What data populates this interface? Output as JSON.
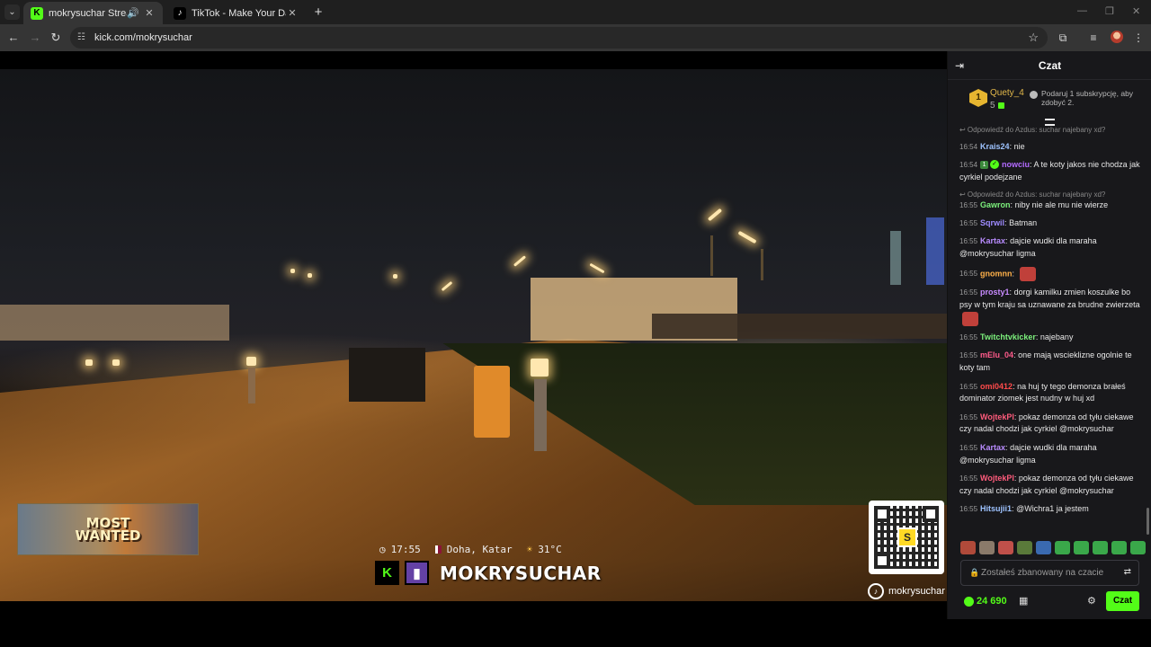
{
  "browser": {
    "tabs": [
      {
        "title": "mokrysuchar Stream - Watc",
        "active": true,
        "favicon": "kick-icon",
        "audio": true
      },
      {
        "title": "TikTok - Make Your Day",
        "active": false,
        "favicon": "tiktok-icon"
      }
    ],
    "url": "kick.com/mokrysuchar"
  },
  "video": {
    "overlay_ad_text": "MOST\nWANTED",
    "info": {
      "time": "17:55",
      "location": "Doha, Katar",
      "temperature": "31°C"
    },
    "streamer_name": "MOKRYSUCHAR",
    "qr_label": "S",
    "handle": "mokrysuchar"
  },
  "chat": {
    "title": "Czat",
    "leaderboard": {
      "rank": "1",
      "name": "Quety_4",
      "count": "5"
    },
    "gift_text": "Podaruj 1 subskrypcję, aby zdobyć 2.",
    "messages": [
      {
        "reply": "Odpowiedź do Azdus: suchar najebany xd?",
        "time": "",
        "user": "",
        "text": "",
        "color": "#888"
      },
      {
        "time": "16:54",
        "user": "Krais24",
        "text": "nie",
        "color": "#9ec3ff"
      },
      {
        "time": "16:54",
        "user": "nowciu",
        "text": "A te koty jakos nie chodza jak cyrkiel podejzane",
        "color": "#b36bff",
        "badges": [
          "sub",
          "verified"
        ]
      },
      {
        "reply": "Odpowiedź do Azdus: suchar najebany xd?",
        "time": "16:55",
        "user": "Gawron",
        "text": "niby nie ale mu nie wierze",
        "color": "#7cf07c"
      },
      {
        "time": "16:55",
        "user": "Sqrwil",
        "text": "Batman",
        "color": "#9e8bff"
      },
      {
        "time": "16:55",
        "user": "Kartax",
        "text": "dajcie wudki dla maraha @mokrysuchar ligma",
        "color": "#b98cff"
      },
      {
        "time": "16:55",
        "user": "gnomnn",
        "text": "",
        "color": "#ffb14a",
        "emote": true
      },
      {
        "time": "16:55",
        "user": "prosty1",
        "text": "dorgi kamilku zmien koszulke bo psy w tym kraju sa uznawane za brudne zwierzeta",
        "color": "#c88bff",
        "emote": true
      },
      {
        "time": "16:55",
        "user": "Twitchtvkicker",
        "text": "najebany",
        "color": "#7cf07c"
      },
      {
        "time": "16:55",
        "user": "mElu_04",
        "text": "one mają wscieklizne ogolnie te koty tam",
        "color": "#ff5b8b"
      },
      {
        "time": "16:55",
        "user": "omi0412",
        "text": "na huj ty tego demonza brałeś dominator ziomek jest nudny w huj xd",
        "color": "#ff4b4b"
      },
      {
        "time": "16:55",
        "user": "WojtekPl",
        "text": "pokaz demonza od tyłu ciekawe czy nadal chodzi jak cyrkiel @mokrysuchar",
        "color": "#ff5b7b"
      },
      {
        "time": "16:55",
        "user": "Kartax",
        "text": "dajcie wudki dla maraha @mokrysuchar ligma",
        "color": "#b98cff"
      },
      {
        "time": "16:55",
        "user": "WojtekPl",
        "text": "pokaz demonza od tyłu ciekawe czy nadal chodzi jak cyrkiel @mokrysuchar",
        "color": "#ff5b7b"
      },
      {
        "time": "16:55",
        "user": "Hitsujii1",
        "text": "@Wichra1 ja jestem",
        "color": "#9ec3ff"
      }
    ],
    "input_placeholder": "Zostałeś zbanowany na czacie",
    "points": "24 690",
    "send_label": "Czat"
  }
}
